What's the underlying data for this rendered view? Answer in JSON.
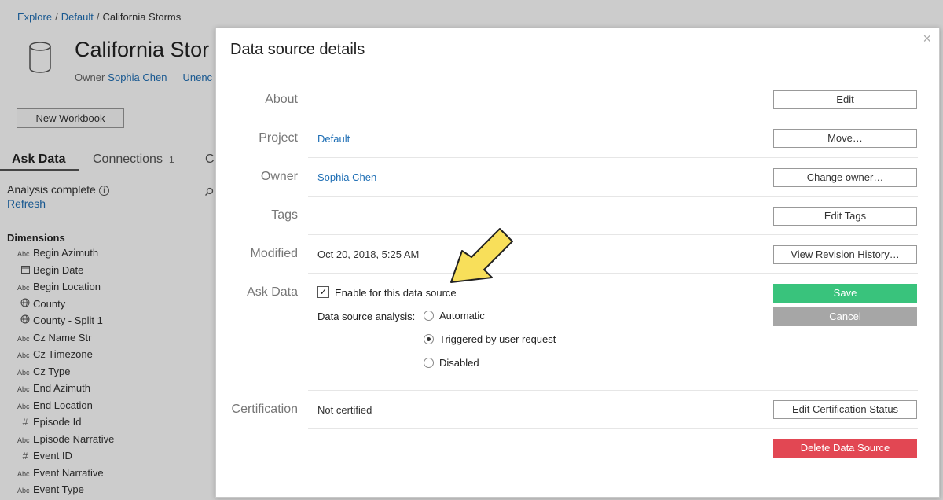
{
  "breadcrumb": {
    "items": [
      "Explore",
      "Default",
      "California Storms"
    ],
    "separator": "/"
  },
  "datasource": {
    "title": "California Stor",
    "owner_label": "Owner",
    "owner_name": "Sophia Chen",
    "unenc_text": "Unenc"
  },
  "new_workbook_label": "New Workbook",
  "tabs": {
    "ask_data": "Ask Data",
    "connections": "Connections",
    "connections_count": "1",
    "partial": "C"
  },
  "analysis": {
    "status": "Analysis complete",
    "info_glyph": "i",
    "refresh": "Refresh"
  },
  "dimensions": {
    "heading": "Dimensions",
    "items": [
      {
        "type": "Abc",
        "label": "Begin Azimuth"
      },
      {
        "type": "date",
        "label": "Begin Date"
      },
      {
        "type": "Abc",
        "label": "Begin Location"
      },
      {
        "type": "geo",
        "label": "County"
      },
      {
        "type": "geo",
        "label": "County - Split 1"
      },
      {
        "type": "Abc",
        "label": "Cz Name Str"
      },
      {
        "type": "Abc",
        "label": "Cz Timezone"
      },
      {
        "type": "Abc",
        "label": "Cz Type"
      },
      {
        "type": "Abc",
        "label": "End Azimuth"
      },
      {
        "type": "Abc",
        "label": "End Location"
      },
      {
        "type": "num",
        "label": "Episode Id"
      },
      {
        "type": "Abc",
        "label": "Episode Narrative"
      },
      {
        "type": "num",
        "label": "Event ID"
      },
      {
        "type": "Abc",
        "label": "Event Narrative"
      },
      {
        "type": "Abc",
        "label": "Event Type"
      }
    ]
  },
  "modal": {
    "title": "Data source details",
    "close_glyph": "×",
    "about": {
      "label": "About",
      "button": "Edit"
    },
    "project": {
      "label": "Project",
      "value": "Default",
      "button": "Move…"
    },
    "owner": {
      "label": "Owner",
      "value": "Sophia Chen",
      "button": "Change owner…"
    },
    "tags": {
      "label": "Tags",
      "button": "Edit Tags"
    },
    "modified": {
      "label": "Modified",
      "value": "Oct 20, 2018, 5:25 AM",
      "button": "View Revision History…"
    },
    "ask_data": {
      "label": "Ask Data",
      "enable_checked": true,
      "check_glyph": "✓",
      "enable_label": "Enable for this data source",
      "analysis_label": "Data source analysis:",
      "options": [
        {
          "label": "Automatic",
          "selected": false
        },
        {
          "label": "Triggered by user request",
          "selected": true
        },
        {
          "label": "Disabled",
          "selected": false
        }
      ],
      "save": "Save",
      "cancel": "Cancel"
    },
    "certification": {
      "label": "Certification",
      "value": "Not certified",
      "button": "Edit Certification Status"
    },
    "delete_button": "Delete Data Source"
  },
  "colors": {
    "link": "#1f6fb5",
    "save": "#39c37c",
    "cancel": "#a6a6a6",
    "delete": "#e24753",
    "arrow": "#f8df5a"
  }
}
